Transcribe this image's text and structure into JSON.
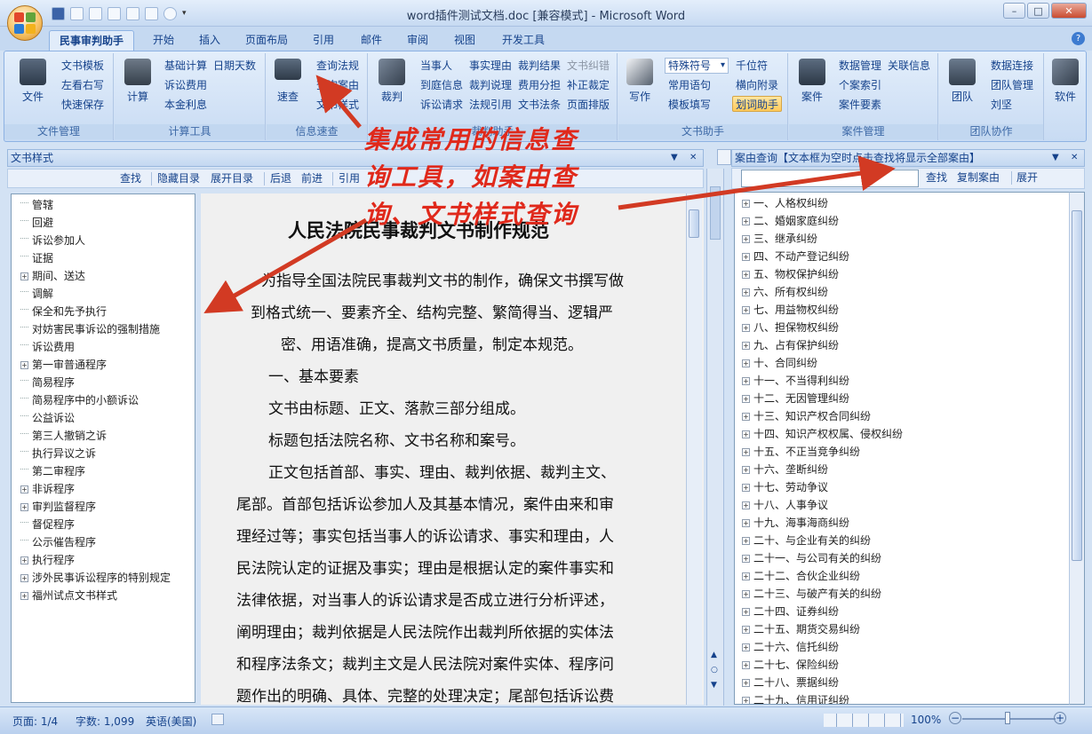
{
  "window": {
    "title": "word插件测试文档.doc [兼容模式] - Microsoft Word",
    "minimize": "–",
    "maximize": "□",
    "close": "✕"
  },
  "tabs": [
    "民事审判助手",
    "开始",
    "插入",
    "页面布局",
    "引用",
    "邮件",
    "审阅",
    "视图",
    "开发工具"
  ],
  "help": "?",
  "ribbon": {
    "g1": {
      "label": "文件管理",
      "big": "文件",
      "items": [
        "文书模板",
        "左看右写",
        "快速保存"
      ]
    },
    "g2": {
      "label": "计算工具",
      "big": "计算",
      "items": [
        "基础计算",
        "日期天数",
        "诉讼费用",
        "本金利息"
      ]
    },
    "g3": {
      "label": "信息速查",
      "big": "速查",
      "items": [
        "查询法规",
        "查询案由",
        "文书样式"
      ]
    },
    "g4": {
      "label": "裁判助手",
      "big": "裁判",
      "items": [
        "当事人",
        "事实理由",
        "裁判结果",
        "文书纠错",
        "到庭信息",
        "裁判说理",
        "费用分担",
        "补正裁定",
        "诉讼请求",
        "法规引用",
        "文书法条",
        "页面排版"
      ]
    },
    "g5": {
      "label": "文书助手",
      "big": "写作",
      "combo": "特殊符号",
      "items": [
        "千位符",
        "常用语句",
        "横向附录",
        "模板填写",
        "划词助手"
      ]
    },
    "g6": {
      "label": "案件管理",
      "big": "案件",
      "items": [
        "数据管理",
        "关联信息",
        "个案索引",
        "案件要素"
      ]
    },
    "g7": {
      "label": "团队协作",
      "big": "团队",
      "items": [
        "数据连接",
        "团队管理",
        "刘坚"
      ]
    },
    "g8": {
      "big": "软件"
    }
  },
  "left_pane": {
    "title": "文书样式",
    "toolbar": [
      "查找",
      "隐藏目录",
      "展开目录",
      "后退",
      "前进",
      "引用"
    ],
    "items": [
      {
        "t": "管辖",
        "e": false
      },
      {
        "t": "回避",
        "e": false
      },
      {
        "t": "诉讼参加人",
        "e": false
      },
      {
        "t": "证据",
        "e": false
      },
      {
        "t": "期间、送达",
        "e": true
      },
      {
        "t": "调解",
        "e": false
      },
      {
        "t": "保全和先予执行",
        "e": false
      },
      {
        "t": "对妨害民事诉讼的强制措施",
        "e": false
      },
      {
        "t": "诉讼费用",
        "e": false
      },
      {
        "t": "第一审普通程序",
        "e": true
      },
      {
        "t": "简易程序",
        "e": false
      },
      {
        "t": "简易程序中的小额诉讼",
        "e": false
      },
      {
        "t": "公益诉讼",
        "e": false
      },
      {
        "t": "第三人撤销之诉",
        "e": false
      },
      {
        "t": "执行异议之诉",
        "e": false
      },
      {
        "t": "第二审程序",
        "e": false
      },
      {
        "t": "非诉程序",
        "e": true
      },
      {
        "t": "审判监督程序",
        "e": true
      },
      {
        "t": "督促程序",
        "e": false
      },
      {
        "t": "公示催告程序",
        "e": false
      },
      {
        "t": "执行程序",
        "e": true
      },
      {
        "t": "涉外民事诉讼程序的特别规定",
        "e": true
      },
      {
        "t": "福州试点文书样式",
        "e": true
      }
    ]
  },
  "document": {
    "heading": "人民法院民事裁判文书制作规范",
    "lines": [
      "为指导全国法院民事裁判文书的制作，确保文书撰写做",
      "到格式统一、要素齐全、结构完整、繁简得当、逻辑严",
      "密、用语准确，提高文书质量，制定本规范。",
      "一、基本要素",
      "文书由标题、正文、落款三部分组成。",
      "标题包括法院名称、文书名称和案号。",
      "正文包括首部、事实、理由、裁判依据、裁判主文、",
      "尾部。首部包括诉讼参加人及其基本情况，案件由来和审",
      "理经过等；事实包括当事人的诉讼请求、事实和理由，人",
      "民法院认定的证据及事实；理由是根据认定的案件事实和",
      "法律依据，对当事人的诉讼请求是否成立进行分析评述，",
      "阐明理由；裁判依据是人民法院作出裁判所依据的实体法",
      "和程序法条文；裁判主文是人民法院对案件实体、程序问",
      "题作出的明确、具体、完整的处理决定；尾部包括诉讼费"
    ]
  },
  "right_pane": {
    "title": "案由查询【文本框为空时点击查找将显示全部案由】",
    "search_placeholder": "",
    "toolbar": [
      "查找",
      "复制案由",
      "展开"
    ],
    "items": [
      "一、人格权纠纷",
      "二、婚姻家庭纠纷",
      "三、继承纠纷",
      "四、不动产登记纠纷",
      "五、物权保护纠纷",
      "六、所有权纠纷",
      "七、用益物权纠纷",
      "八、担保物权纠纷",
      "九、占有保护纠纷",
      "十、合同纠纷",
      "十一、不当得利纠纷",
      "十二、无因管理纠纷",
      "十三、知识产权合同纠纷",
      "十四、知识产权权属、侵权纠纷",
      "十五、不正当竞争纠纷",
      "十六、垄断纠纷",
      "十七、劳动争议",
      "十八、人事争议",
      "十九、海事海商纠纷",
      "二十、与企业有关的纠纷",
      "二十一、与公司有关的纠纷",
      "二十二、合伙企业纠纷",
      "二十三、与破产有关的纠纷",
      "二十四、证券纠纷",
      "二十五、期货交易纠纷",
      "二十六、信托纠纷",
      "二十七、保险纠纷",
      "二十八、票据纠纷",
      "二十九、信用证纠纷"
    ]
  },
  "annotation": {
    "line1": "集成常用的信息查",
    "line2": "询工具，如案由查",
    "line3": "询、文书样式查询",
    "color": "#e0291b"
  },
  "status": {
    "page": "页面: 1/4",
    "words": "字数: 1,099",
    "lang": "英语(美国)",
    "zoom": "100%",
    "zoom_minus": "−",
    "zoom_plus": "+"
  },
  "colors": {
    "ribbon_text": "#15428b",
    "accent": "#c5d9f1",
    "annotation": "#e0291b"
  }
}
